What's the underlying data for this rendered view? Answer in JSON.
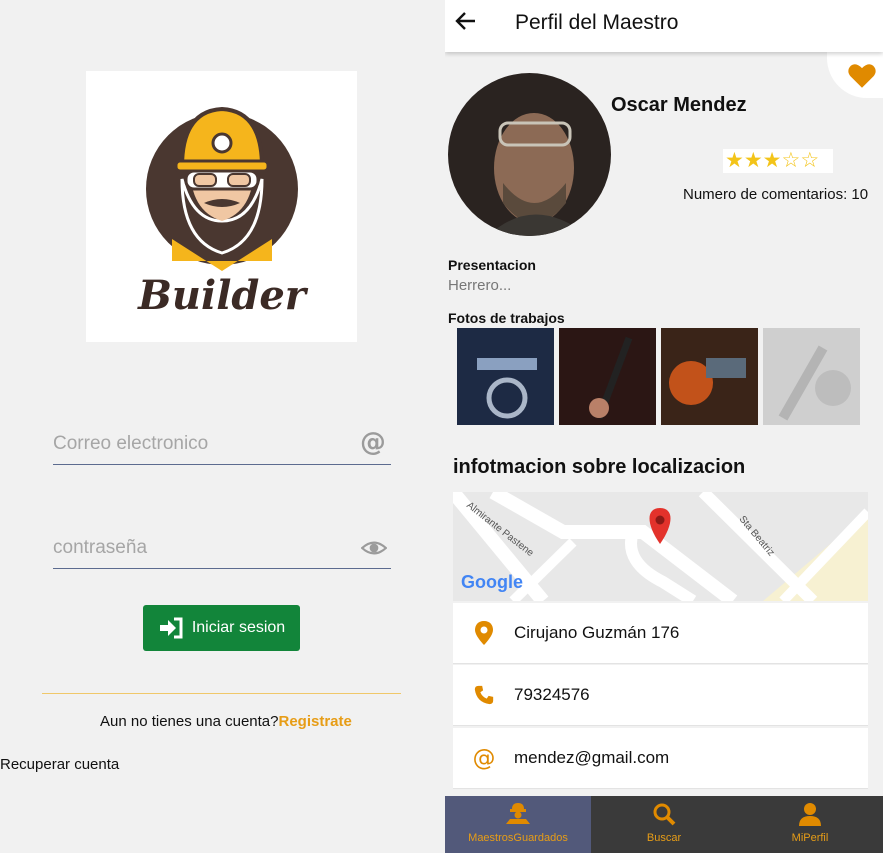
{
  "login": {
    "logo_text": "Builder",
    "email_placeholder": "Correo electronico",
    "password_placeholder": "contraseña",
    "login_button": "Iniciar sesion",
    "signup_prompt": "Aun no tienes una cuenta?",
    "signup_link": "Registrate",
    "recover_link": "Recuperar cuenta"
  },
  "profile": {
    "header_title": "Perfil del Maestro",
    "name": "Oscar Mendez",
    "rating": 3,
    "rating_max": 5,
    "comments_label": "Numero de comentarios: 10",
    "presentation_label": "Presentacion",
    "presentation_text": "Herrero...",
    "photos_label": "Fotos de trabajos",
    "location_title": "infotmacion sobre localizacion",
    "map": {
      "street_1": "Almirante Pastene",
      "street_2": "Sta Beatriz",
      "provider": "Google"
    },
    "address": "Cirujano Guzmán 176",
    "phone": "79324576",
    "email": "mendez@gmail.com",
    "accent_color": "#e08a00"
  },
  "nav": {
    "items": [
      {
        "label": "MaestrosGuardados",
        "icon": "worker-icon",
        "active": true
      },
      {
        "label": "Buscar",
        "icon": "search-icon",
        "active": false
      },
      {
        "label": "MiPerfil",
        "icon": "person-icon",
        "active": false
      }
    ]
  }
}
